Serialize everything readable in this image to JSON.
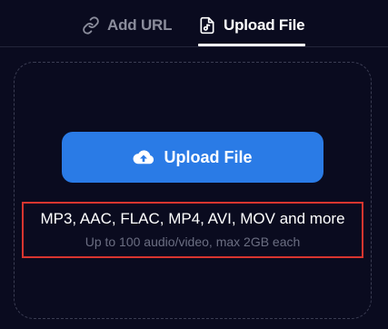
{
  "tabs": [
    {
      "label": "Add URL",
      "icon": "link-icon",
      "active": false
    },
    {
      "label": "Upload File",
      "icon": "music-file-icon",
      "active": true
    }
  ],
  "upload": {
    "button_label": "Upload File",
    "button_icon": "cloud-upload-icon",
    "formats": "MP3, AAC, FLAC, MP4, AVI, MOV and more",
    "limits": "Up to 100 audio/video, max 2GB each"
  },
  "colors": {
    "background": "#0a0b1f",
    "accent": "#2a7be6",
    "inactive_text": "#8b8d9c",
    "highlight_border": "#d8352f"
  }
}
